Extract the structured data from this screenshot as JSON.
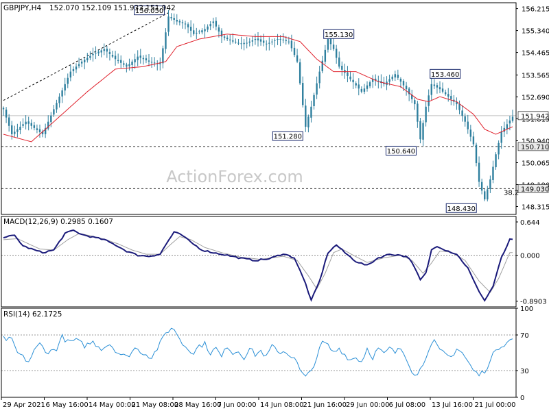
{
  "header": {
    "symbol": "GBPJPY,H4",
    "ohlc": "152.070 152.109 151.933 151.942"
  },
  "watermark": "ActionForex.com",
  "colors": {
    "candle": "#2e7f9e",
    "ma": "#e0202b",
    "trendline": "#000000",
    "macd": "#1a1a7a",
    "signal": "#a0a0a0",
    "rsi": "#2a8fd6",
    "label_border": "#1a2a6c"
  },
  "chart_data": [
    {
      "type": "candlestick",
      "name": "GBPJPY,H4",
      "ylim": [
        148.0,
        156.45
      ],
      "yticks": [
        "156.215",
        "155.340",
        "154.465",
        "153.565",
        "152.690",
        "151.815",
        "150.940",
        "150.065",
        "149.190",
        "148.315"
      ],
      "current_price": 151.942,
      "current_price_label": "151.942",
      "hlines": [
        {
          "value": 150.71,
          "label": "150.710",
          "style": "dotted"
        },
        {
          "value": 149.03,
          "label": "149.030",
          "style": "dotted"
        }
      ],
      "fib_label": "38.2",
      "x_categories": [
        "29 Apr 2021",
        "6 May 16:00",
        "14 May 00:00",
        "21 May 08:00",
        "28 May 16:00",
        "7 Jun 00:00",
        "14 Jun 08:00",
        "21 Jun 16:00",
        "29 Jun 00:00",
        "6 Jul 08:00",
        "13 Jul 16:00",
        "21 Jul 00:00"
      ],
      "annotations": [
        {
          "text": "156.050",
          "x_bar": 59,
          "value": 156.05
        },
        {
          "text": "155.130",
          "x_bar": 113,
          "value": 155.13
        },
        {
          "text": "151.280",
          "x_bar": 108,
          "value": 151.28
        },
        {
          "text": "153.460",
          "x_bar": 152,
          "value": 153.46
        },
        {
          "text": "150.640",
          "x_bar": 149,
          "value": 150.64
        },
        {
          "text": "148.430",
          "x_bar": 172,
          "value": 148.43
        }
      ],
      "keypoints": [
        [
          0,
          152.2
        ],
        [
          3,
          151.2
        ],
        [
          8,
          151.7
        ],
        [
          14,
          151.2
        ],
        [
          20,
          152.7
        ],
        [
          24,
          153.7
        ],
        [
          28,
          154.1
        ],
        [
          32,
          154.4
        ],
        [
          36,
          154.6
        ],
        [
          40,
          154.2
        ],
        [
          44,
          153.9
        ],
        [
          48,
          154.3
        ],
        [
          52,
          154.1
        ],
        [
          56,
          154.0
        ],
        [
          59,
          155.9
        ],
        [
          62,
          155.7
        ],
        [
          65,
          155.6
        ],
        [
          68,
          155.2
        ],
        [
          72,
          155.4
        ],
        [
          75,
          155.7
        ],
        [
          78,
          155.1
        ],
        [
          82,
          154.9
        ],
        [
          86,
          154.8
        ],
        [
          90,
          155.0
        ],
        [
          94,
          154.8
        ],
        [
          98,
          155.0
        ],
        [
          102,
          154.9
        ],
        [
          105,
          154.1
        ],
        [
          108,
          151.5
        ],
        [
          110,
          152.3
        ],
        [
          113,
          153.7
        ],
        [
          116,
          155.0
        ],
        [
          118,
          154.6
        ],
        [
          120,
          153.9
        ],
        [
          124,
          153.4
        ],
        [
          128,
          152.9
        ],
        [
          132,
          153.4
        ],
        [
          136,
          153.2
        ],
        [
          140,
          153.6
        ],
        [
          144,
          153.0
        ],
        [
          147,
          152.4
        ],
        [
          149,
          151.0
        ],
        [
          151,
          152.3
        ],
        [
          153,
          153.2
        ],
        [
          156,
          153.0
        ],
        [
          159,
          152.7
        ],
        [
          162,
          152.4
        ],
        [
          165,
          151.7
        ],
        [
          168,
          150.8
        ],
        [
          170,
          149.3
        ],
        [
          172,
          148.6
        ],
        [
          174,
          149.4
        ],
        [
          176,
          150.4
        ],
        [
          178,
          151.3
        ],
        [
          180,
          151.6
        ],
        [
          182,
          151.9
        ]
      ],
      "ma_keypoints": [
        [
          0,
          151.2
        ],
        [
          10,
          150.9
        ],
        [
          20,
          151.9
        ],
        [
          30,
          152.9
        ],
        [
          40,
          153.8
        ],
        [
          50,
          153.9
        ],
        [
          58,
          154.1
        ],
        [
          62,
          154.7
        ],
        [
          70,
          155.0
        ],
        [
          80,
          155.2
        ],
        [
          90,
          155.1
        ],
        [
          100,
          155.1
        ],
        [
          106,
          154.9
        ],
        [
          112,
          154.2
        ],
        [
          118,
          153.7
        ],
        [
          126,
          153.7
        ],
        [
          134,
          153.3
        ],
        [
          142,
          153.1
        ],
        [
          148,
          152.6
        ],
        [
          152,
          152.5
        ],
        [
          156,
          152.7
        ],
        [
          162,
          152.5
        ],
        [
          168,
          152.0
        ],
        [
          172,
          151.4
        ],
        [
          176,
          151.2
        ],
        [
          182,
          151.5
        ]
      ]
    },
    {
      "type": "line",
      "title": "MACD(12,26,9) 0.2985 0.1607",
      "ylim": [
        -1.0,
        0.75
      ],
      "yticks": [
        {
          "value": 0.644,
          "label": "0.644"
        },
        {
          "value": 0.0,
          "label": "0.000"
        },
        {
          "value": -0.8903,
          "label": "-0.8903"
        }
      ],
      "series": [
        {
          "name": "MACD",
          "keypoints": [
            [
              0,
              0.35
            ],
            [
              4,
              0.38
            ],
            [
              7,
              0.18
            ],
            [
              10,
              0.12
            ],
            [
              14,
              0.05
            ],
            [
              18,
              0.1
            ],
            [
              22,
              0.42
            ],
            [
              25,
              0.48
            ],
            [
              28,
              0.4
            ],
            [
              32,
              0.35
            ],
            [
              36,
              0.3
            ],
            [
              40,
              0.2
            ],
            [
              44,
              0.08
            ],
            [
              48,
              0.0
            ],
            [
              52,
              -0.02
            ],
            [
              56,
              0.02
            ],
            [
              58,
              0.2
            ],
            [
              61,
              0.45
            ],
            [
              64,
              0.38
            ],
            [
              67,
              0.25
            ],
            [
              71,
              0.1
            ],
            [
              75,
              0.05
            ],
            [
              80,
              0.0
            ],
            [
              85,
              -0.06
            ],
            [
              90,
              -0.1
            ],
            [
              95,
              -0.07
            ],
            [
              100,
              0.03
            ],
            [
              104,
              -0.05
            ],
            [
              108,
              -0.55
            ],
            [
              110,
              -0.88
            ],
            [
              113,
              -0.5
            ],
            [
              116,
              0.05
            ],
            [
              119,
              0.2
            ],
            [
              122,
              0.05
            ],
            [
              126,
              -0.12
            ],
            [
              130,
              -0.2
            ],
            [
              134,
              -0.05
            ],
            [
              138,
              0.02
            ],
            [
              142,
              0.0
            ],
            [
              145,
              -0.05
            ],
            [
              147,
              -0.25
            ],
            [
              149,
              -0.48
            ],
            [
              151,
              -0.35
            ],
            [
              153,
              0.1
            ],
            [
              155,
              0.18
            ],
            [
              158,
              0.1
            ],
            [
              162,
              0.02
            ],
            [
              166,
              -0.25
            ],
            [
              169,
              -0.6
            ],
            [
              172,
              -0.88
            ],
            [
              175,
              -0.6
            ],
            [
              178,
              -0.05
            ],
            [
              181,
              0.3
            ]
          ]
        },
        {
          "name": "Signal",
          "keypoints": [
            [
              0,
              0.3
            ],
            [
              5,
              0.32
            ],
            [
              9,
              0.22
            ],
            [
              13,
              0.12
            ],
            [
              18,
              0.1
            ],
            [
              23,
              0.3
            ],
            [
              27,
              0.42
            ],
            [
              31,
              0.38
            ],
            [
              36,
              0.31
            ],
            [
              41,
              0.22
            ],
            [
              46,
              0.1
            ],
            [
              51,
              0.02
            ],
            [
              56,
              0.02
            ],
            [
              60,
              0.22
            ],
            [
              63,
              0.36
            ],
            [
              67,
              0.3
            ],
            [
              72,
              0.15
            ],
            [
              78,
              0.05
            ],
            [
              85,
              -0.04
            ],
            [
              92,
              -0.08
            ],
            [
              100,
              -0.02
            ],
            [
              105,
              -0.1
            ],
            [
              109,
              -0.4
            ],
            [
              112,
              -0.65
            ],
            [
              115,
              -0.35
            ],
            [
              118,
              0.05
            ],
            [
              121,
              0.12
            ],
            [
              125,
              0.0
            ],
            [
              130,
              -0.14
            ],
            [
              136,
              -0.05
            ],
            [
              142,
              0.0
            ],
            [
              146,
              -0.1
            ],
            [
              150,
              -0.35
            ],
            [
              153,
              -0.15
            ],
            [
              156,
              0.08
            ],
            [
              160,
              0.06
            ],
            [
              165,
              -0.1
            ],
            [
              170,
              -0.5
            ],
            [
              174,
              -0.72
            ],
            [
              177,
              -0.45
            ],
            [
              181,
              0.05
            ]
          ]
        }
      ]
    },
    {
      "type": "line",
      "title": "RSI(14) 62.1725",
      "ylim": [
        0,
        100
      ],
      "yticks": [
        {
          "value": 100,
          "label": "100"
        },
        {
          "value": 70,
          "label": "70"
        },
        {
          "value": 30,
          "label": "30"
        },
        {
          "value": 0,
          "label": "0"
        }
      ],
      "hlines": [
        70,
        30
      ],
      "series": [
        {
          "name": "RSI",
          "keypoints": [
            [
              0,
              66
            ],
            [
              3,
              64
            ],
            [
              5,
              50
            ],
            [
              7,
              45
            ],
            [
              9,
              40
            ],
            [
              11,
              52
            ],
            [
              13,
              60
            ],
            [
              16,
              50
            ],
            [
              19,
              55
            ],
            [
              21,
              68
            ],
            [
              23,
              62
            ],
            [
              26,
              64
            ],
            [
              29,
              58
            ],
            [
              32,
              62
            ],
            [
              35,
              55
            ],
            [
              38,
              60
            ],
            [
              41,
              50
            ],
            [
              44,
              45
            ],
            [
              47,
              55
            ],
            [
              50,
              50
            ],
            [
              53,
              45
            ],
            [
              56,
              60
            ],
            [
              58,
              72
            ],
            [
              60,
              78
            ],
            [
              62,
              72
            ],
            [
              64,
              60
            ],
            [
              66,
              55
            ],
            [
              68,
              50
            ],
            [
              70,
              58
            ],
            [
              72,
              60
            ],
            [
              74,
              50
            ],
            [
              76,
              55
            ],
            [
              78,
              45
            ],
            [
              80,
              58
            ],
            [
              82,
              50
            ],
            [
              84,
              52
            ],
            [
              86,
              45
            ],
            [
              88,
              55
            ],
            [
              90,
              48
            ],
            [
              92,
              52
            ],
            [
              94,
              45
            ],
            [
              96,
              58
            ],
            [
              98,
              50
            ],
            [
              100,
              52
            ],
            [
              102,
              48
            ],
            [
              104,
              45
            ],
            [
              106,
              30
            ],
            [
              108,
              22
            ],
            [
              110,
              30
            ],
            [
              112,
              45
            ],
            [
              114,
              62
            ],
            [
              116,
              58
            ],
            [
              118,
              50
            ],
            [
              120,
              55
            ],
            [
              122,
              48
            ],
            [
              124,
              42
            ],
            [
              126,
              45
            ],
            [
              128,
              40
            ],
            [
              130,
              55
            ],
            [
              132,
              45
            ],
            [
              134,
              55
            ],
            [
              136,
              48
            ],
            [
              138,
              55
            ],
            [
              140,
              50
            ],
            [
              142,
              55
            ],
            [
              144,
              45
            ],
            [
              146,
              30
            ],
            [
              148,
              25
            ],
            [
              150,
              38
            ],
            [
              152,
              55
            ],
            [
              154,
              62
            ],
            [
              156,
              52
            ],
            [
              158,
              48
            ],
            [
              160,
              45
            ],
            [
              162,
              55
            ],
            [
              164,
              50
            ],
            [
              166,
              40
            ],
            [
              168,
              30
            ],
            [
              170,
              25
            ],
            [
              172,
              30
            ],
            [
              174,
              40
            ],
            [
              176,
              55
            ],
            [
              178,
              58
            ],
            [
              180,
              62
            ],
            [
              182,
              65
            ]
          ]
        }
      ]
    }
  ]
}
